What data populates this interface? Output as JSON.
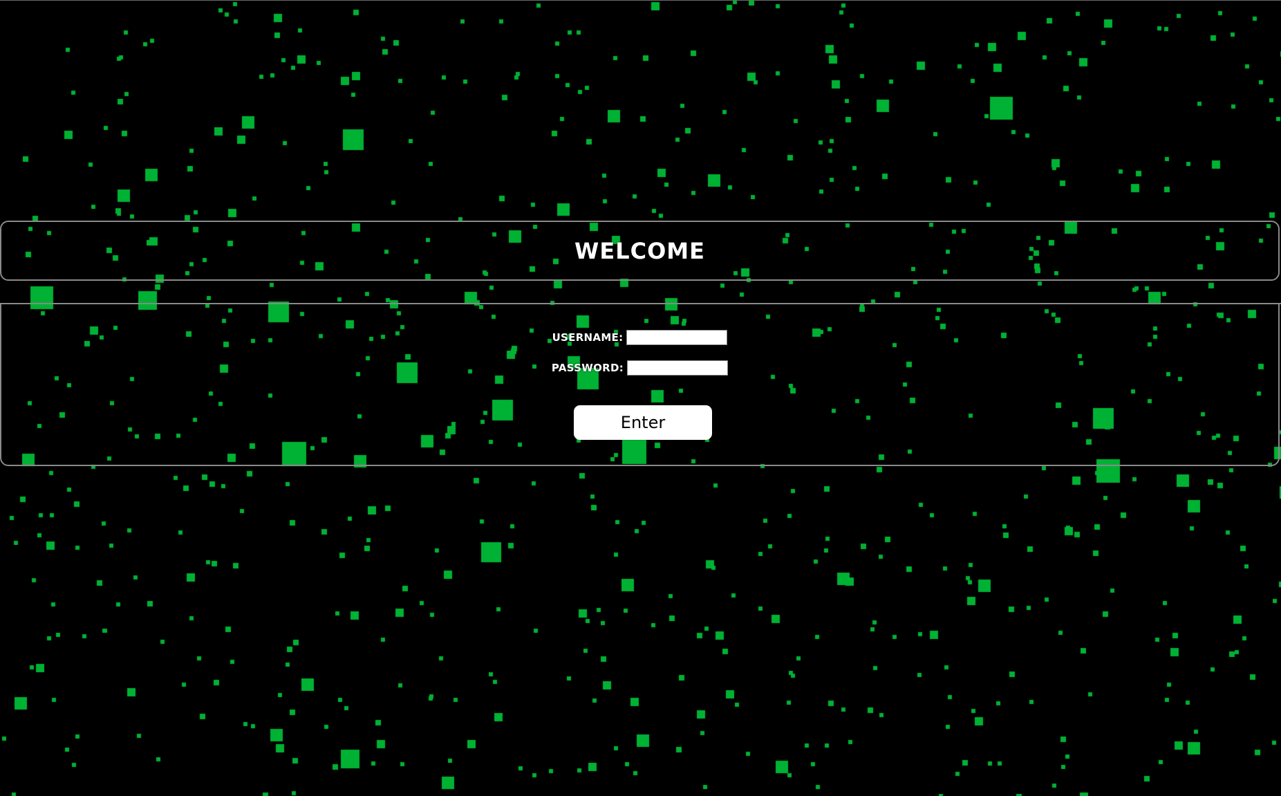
{
  "page": {
    "background_color": "#000000",
    "particle_color": "#00b233"
  },
  "header": {
    "title": "WELCOME"
  },
  "login_form": {
    "username_label": "USERNAME:",
    "username_value": "",
    "password_label": "PASSWORD:",
    "password_value": "",
    "submit_label": "Enter"
  }
}
